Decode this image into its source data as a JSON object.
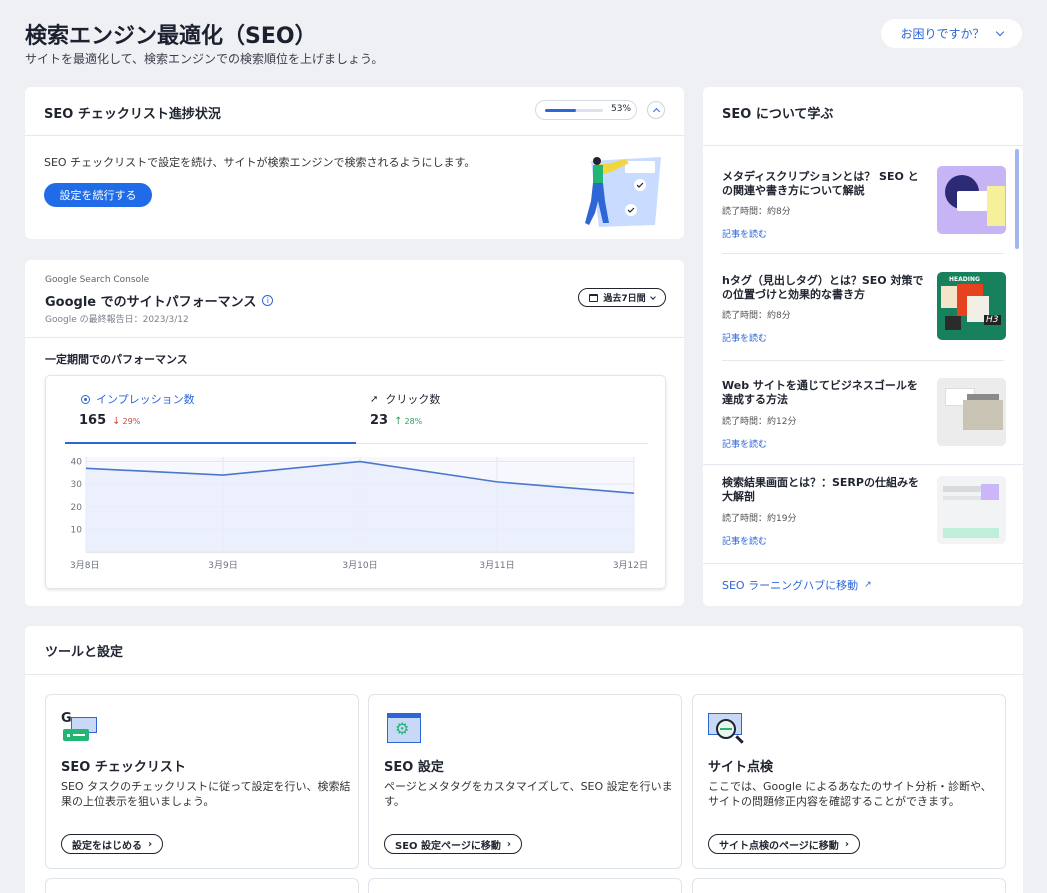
{
  "header": {
    "title": "検索エンジン最適化（SEO）",
    "subtitle": "サイトを最適化して、検索エンジンでの検索順位を上げましょう。",
    "help_label": "お困りですか？"
  },
  "checklist": {
    "title": "SEO チェックリスト進捗状況",
    "progress_label": "53%",
    "progress": 0.53,
    "description": "SEO チェックリストで設定を続け、サイトが検索エンジンで検索されるようにします。",
    "continue_label": "設定を続行する"
  },
  "performance": {
    "brand": "Google Search Console",
    "title": "Google でのサイトパフォーマンス",
    "last_report": "Google の最終報告日：2023/3/12",
    "range_label": "過去7日間",
    "section_title": "一定期間でのパフォーマンス",
    "tabs": [
      {
        "label": "インプレッション数",
        "value": "165",
        "change": "29%",
        "trend": "down"
      },
      {
        "label": "クリック数",
        "value": "23",
        "change": "28%",
        "trend": "up"
      }
    ]
  },
  "chart_data": {
    "type": "area",
    "x": [
      "3月8日",
      "3月9日",
      "3月10日",
      "3月11日",
      "3月12日"
    ],
    "series": [
      {
        "values": [
          37,
          34,
          40,
          31,
          26
        ]
      }
    ],
    "yticks": [
      "10",
      "20",
      "30",
      "40"
    ],
    "ylim": [
      0,
      42
    ],
    "grid": true,
    "color": "#4a77cc"
  },
  "learn": {
    "title": "SEO について学ぶ",
    "articles": [
      {
        "title": "メタディスクリプションとは？ SEO との関連や書き方について解説",
        "time": "読了時間：約8分",
        "link": "記事を読む"
      },
      {
        "title": "hタグ（見出しタグ）とは？SEO 対策での位置づけと効果的な書き方",
        "time": "読了時間：約8分",
        "link": "記事を読む"
      },
      {
        "title": "Web サイトを通じてビジネスゴールを達成する方法",
        "time": "読了時間：約12分",
        "link": "記事を読む"
      },
      {
        "title": "検索結果画面とは？：SERPの仕組みを大解剖",
        "time": "読了時間：約19分",
        "link": "記事を読む"
      }
    ],
    "hub_link": "SEO ラーニングハブに移動",
    "thumb_texts": {
      "heading": "HEADING",
      "h3": "H3"
    }
  },
  "tools": {
    "title": "ツールと設定",
    "cards": [
      {
        "title": "SEO チェックリスト",
        "desc": "SEO タスクのチェックリストに従って設定を行い、検索結果の上位表示を狙いましょう。",
        "button": "設定をはじめる",
        "icon_letter": "G"
      },
      {
        "title": "SEO 設定",
        "desc": "ページとメタタグをカスタマイズして、SEO 設定を行います。",
        "button": "SEO 設定ページに移動"
      },
      {
        "title": "サイト点検",
        "desc": "ここでは、Google によるあなたのサイト分析・診断や、サイトの問題修正内容を確認することができます。",
        "button": "サイト点検のページに移動"
      }
    ]
  }
}
